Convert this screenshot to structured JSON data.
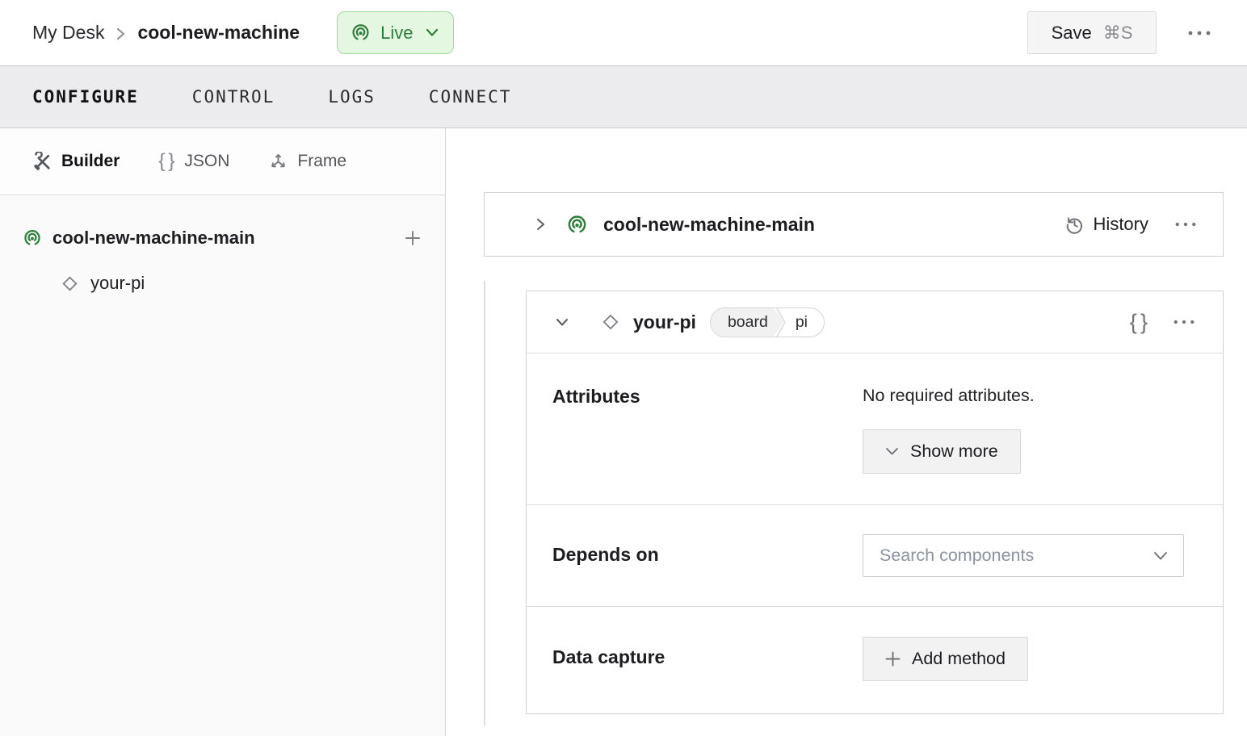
{
  "header": {
    "breadcrumb": {
      "parent": "My Desk",
      "current": "cool-new-machine"
    },
    "live_badge": {
      "label": "Live"
    },
    "save_button": {
      "label": "Save",
      "shortcut": "⌘S"
    }
  },
  "tabs": {
    "configure": "CONFIGURE",
    "control": "CONTROL",
    "logs": "LOGS",
    "connect": "CONNECT"
  },
  "sidebar": {
    "views": {
      "builder": "Builder",
      "json": "JSON",
      "frame": "Frame"
    },
    "tree": {
      "machine": "cool-new-machine-main",
      "component": "your-pi"
    }
  },
  "main": {
    "machine_card": {
      "title": "cool-new-machine-main",
      "history": "History"
    },
    "component_card": {
      "title": "your-pi",
      "type_badge": {
        "type": "board",
        "model": "pi"
      },
      "attributes": {
        "label": "Attributes",
        "empty_text": "No required attributes.",
        "show_more": "Show more"
      },
      "depends_on": {
        "label": "Depends on",
        "placeholder": "Search components"
      },
      "data_capture": {
        "label": "Data capture",
        "add_method": "Add method"
      }
    }
  },
  "icons": {
    "live": "broadcast-icon",
    "builder": "tools-icon",
    "json": "braces-icon",
    "frame": "axes-icon",
    "machine": "broadcast-icon",
    "component": "diamond-icon",
    "history": "history-clock-icon",
    "menu": "ellipsis-icon"
  },
  "colors": {
    "live_bg": "#e4f7e1",
    "live_border": "#a0d7a2",
    "live_text": "#2e7d3b",
    "machine_green": "#2e7d3b",
    "tabbar_bg": "#ececef",
    "card_border": "#d2d2d5",
    "button_bg": "#f2f2f3",
    "placeholder_text": "#8b93a1"
  }
}
